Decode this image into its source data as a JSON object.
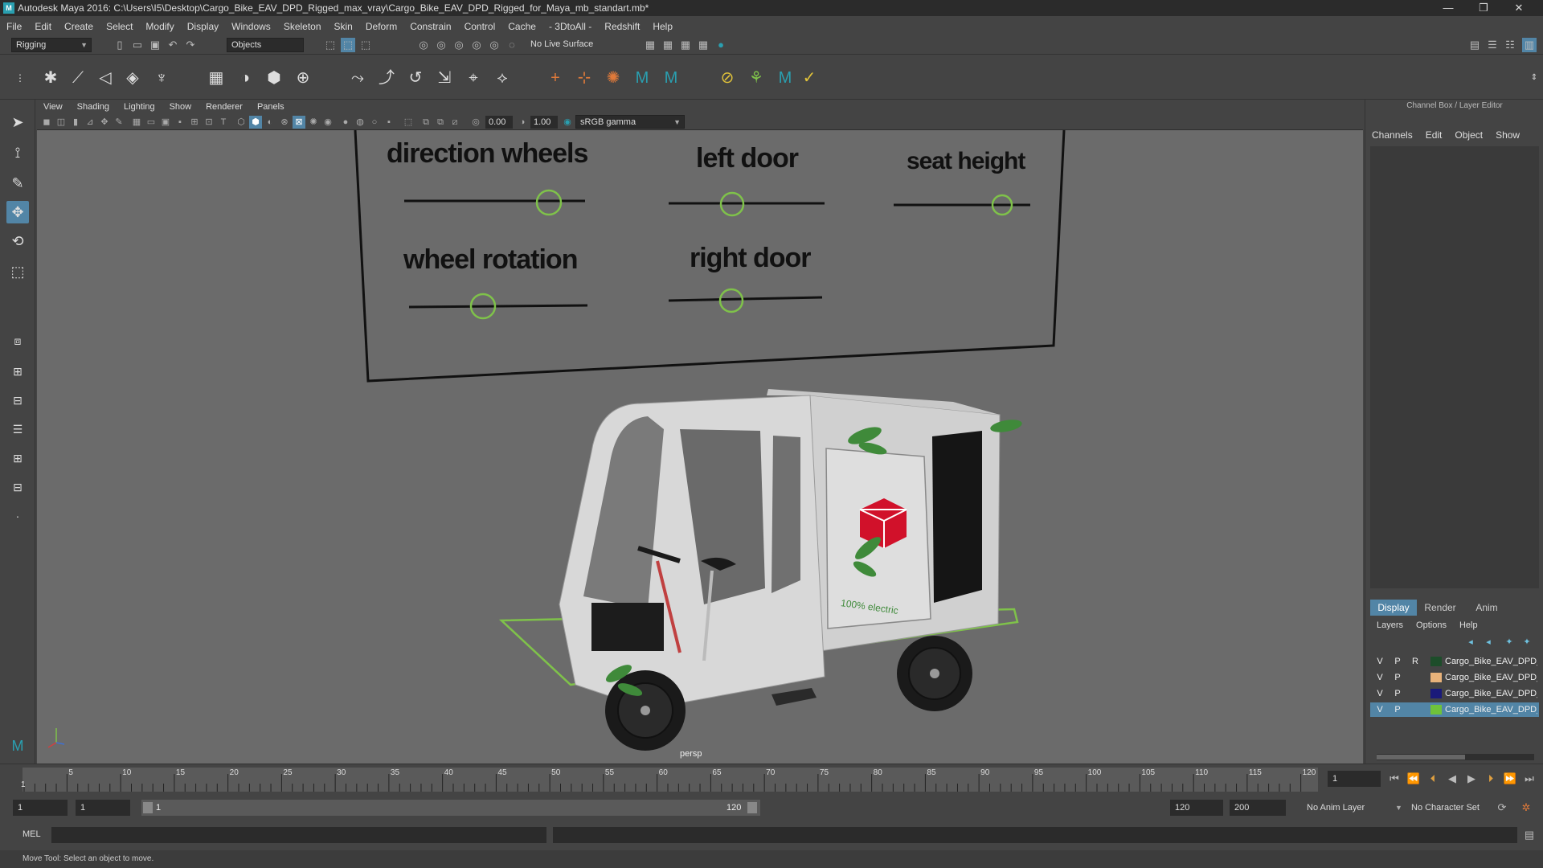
{
  "window": {
    "title": "Autodesk Maya 2016: C:\\Users\\I5\\Desktop\\Cargo_Bike_EAV_DPD_Rigged_max_vray\\Cargo_Bike_EAV_DPD_Rigged_for_Maya_mb_standart.mb*",
    "minimize": "—",
    "restore": "❐",
    "close": "✕"
  },
  "menubar": [
    "File",
    "Edit",
    "Create",
    "Select",
    "Modify",
    "Display",
    "Windows",
    "Skeleton",
    "Skin",
    "Deform",
    "Constrain",
    "Control",
    "Cache",
    "- 3DtoAll -",
    "Redshift",
    "Help"
  ],
  "statusline": {
    "menuset": "Rigging",
    "selection_mode": "Objects",
    "live_surface": "No Live Surface"
  },
  "panel_menu": [
    "View",
    "Shading",
    "Lighting",
    "Show",
    "Renderer",
    "Panels"
  ],
  "panel_toolbar": {
    "exposure": "0.00",
    "gamma": "1.00",
    "color_space": "sRGB gamma"
  },
  "viewport": {
    "camera": "persp",
    "controls": {
      "direction_wheels": "direction wheels",
      "left_door": "left door",
      "seat_height": "seat height",
      "wheel_rotation": "wheel rotation",
      "right_door": "right door"
    },
    "decal": "100% electric",
    "colors": {
      "background": "#6b6b6b",
      "control_circle": "#7fc24a",
      "bike_body": "#d8d8d8",
      "logo": "#d1112a",
      "leaves": "#3f8a3a"
    }
  },
  "channel_box": {
    "title": "Channel Box / Layer Editor",
    "menu": [
      "Channels",
      "Edit",
      "Object",
      "Show"
    ]
  },
  "layer_editor": {
    "tabs": [
      "Display",
      "Render",
      "Anim"
    ],
    "active_tab": "Display",
    "menu": [
      "Layers",
      "Options",
      "Help"
    ],
    "layers": [
      {
        "v": "V",
        "p": "P",
        "r": "R",
        "color": "#1d4d2a",
        "name": "Cargo_Bike_EAV_DPD_"
      },
      {
        "v": "V",
        "p": "P",
        "r": "",
        "color": "#e8b27a",
        "name": "Cargo_Bike_EAV_DPD_"
      },
      {
        "v": "V",
        "p": "P",
        "r": "",
        "color": "#1a1a7a",
        "name": "Cargo_Bike_EAV_DPD_"
      },
      {
        "v": "V",
        "p": "P",
        "r": "",
        "color": "#6fc23a",
        "name": "Cargo_Bike_EAV_DPD_"
      }
    ]
  },
  "timeline": {
    "ticks": [
      "5",
      "10",
      "15",
      "20",
      "25",
      "30",
      "35",
      "40",
      "45",
      "50",
      "55",
      "60",
      "65",
      "70",
      "75",
      "80",
      "85",
      "90",
      "95",
      "100",
      "105",
      "110",
      "115",
      "120"
    ],
    "start_label": "1",
    "current_frame": "1"
  },
  "range": {
    "start": "1",
    "playback_start": "1",
    "slider_start": "1",
    "slider_end": "120",
    "playback_end": "120",
    "end": "200",
    "anim_layer": "No Anim Layer",
    "character_set": "No Character Set"
  },
  "command_line": {
    "language": "MEL"
  },
  "help_line": "Move Tool: Select an object to move."
}
